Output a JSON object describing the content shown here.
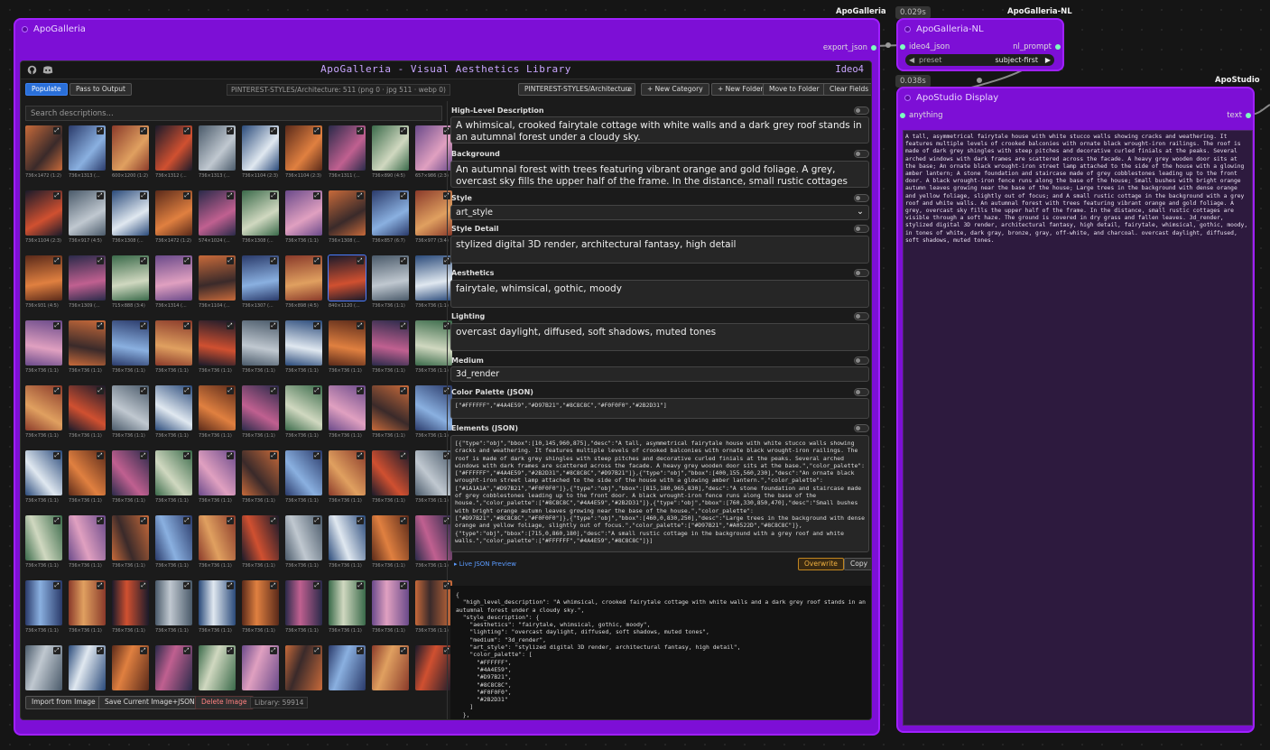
{
  "colors": {
    "node": "#7d0fd6",
    "border": "#a020ff",
    "accent": "#3b82f6",
    "socket": "#7dffc0"
  },
  "tags": {
    "gallery": "ApoGalleria",
    "nl": "ApoGalleria-NL",
    "studio": "ApoStudio"
  },
  "timings": {
    "nl": "0.029s",
    "studio": "0.038s"
  },
  "gallery_node": {
    "title": "ApoGalleria",
    "output": "export_json",
    "header_title": "ApoGalleria - Visual Aesthetics Library",
    "mode": "Ideo4",
    "populate": "Populate",
    "pass": "Pass to Output",
    "status": "PINTEREST-STYLES/Architecture: 511 (png 0 · jpg 511 · webp 0)",
    "category": "PINTEREST-STYLES/Architecture",
    "new_category": "+ New Category",
    "new_folder": "+ New Folder",
    "move": "Move to Folder",
    "clear": "Clear Fields",
    "search_placeholder": "Search descriptions...",
    "import": "Import from Image",
    "save": "Save Current Image+JSON",
    "delete": "Delete Image",
    "library": "Library: 59914"
  },
  "thumbs": [
    [
      "736×1472 (1:2)",
      "736×1313 (...",
      "600×1200 (1:2)",
      "736×1312 (...",
      "736×1313 (...",
      "736×1104 (2:3)",
      "736×1104 (2:3)",
      "736×1311 (...",
      "736×890 (4:5)",
      "657×986 (2:3)"
    ],
    [
      "736×1104 (2:3)",
      "736×917 (4:5)",
      "736×1308 (...",
      "736×1472 (1:2)",
      "574×1024 (...",
      "736×1308 (...",
      "736×736 (1:1)",
      "736×1308 (...",
      "736×857 (6:7)",
      "736×977 (3:4)"
    ],
    [
      "736×931 (4:5)",
      "736×1309 (...",
      "715×888 (3:4)",
      "736×1314 (...",
      "736×1104 (...",
      "736×1307 (...",
      "736×898 (4:5)",
      "840×1120 (...",
      "736×736 (1:1)",
      "736×736 (1:1)"
    ],
    [
      "736×736 (1:1)",
      "736×736 (1:1)",
      "736×736 (1:1)",
      "736×736 (1:1)",
      "736×736 (1:1)",
      "736×736 (1:1)",
      "736×736 (1:1)",
      "736×736 (1:1)",
      "736×736 (1:1)",
      "736×736 (1:1)"
    ],
    [
      "736×736 (1:1)",
      "736×736 (1:1)",
      "736×736 (1:1)",
      "736×736 (1:1)",
      "736×736 (1:1)",
      "736×736 (1:1)",
      "736×736 (1:1)",
      "736×736 (1:1)",
      "736×736 (1:1)",
      "736×736 (1:1)"
    ],
    [
      "736×736 (1:1)",
      "736×736 (1:1)",
      "736×736 (1:1)",
      "736×736 (1:1)",
      "736×736 (1:1)",
      "736×736 (1:1)",
      "736×736 (1:1)",
      "736×736 (1:1)",
      "736×736 (1:1)",
      "736×736 (1:1)"
    ],
    [
      "736×736 (1:1)",
      "736×736 (1:1)",
      "736×736 (1:1)",
      "736×736 (1:1)",
      "736×736 (1:1)",
      "736×736 (1:1)",
      "736×736 (1:1)",
      "736×736 (1:1)",
      "736×736 (1:1)",
      "736×736 (1:1)"
    ],
    [
      "736×736 (1:1)",
      "736×736 (1:1)",
      "736×736 (1:1)",
      "736×736 (1:1)",
      "736×736 (1:1)",
      "736×736 (1:1)",
      "736×736 (1:1)",
      "736×736 (1:1)",
      "736×736 (1:1)",
      "736×736 (1:1)"
    ],
    [
      "",
      "",
      "",
      "",
      "",
      "",
      "",
      "",
      "",
      ""
    ]
  ],
  "fields": {
    "hld_label": "High-Level Description",
    "hld": "A whimsical, crooked fairytale cottage with white walls and a dark grey roof stands in an autumnal forest under a cloudy sky.",
    "bg_label": "Background",
    "bg": "An autumnal forest with trees featuring vibrant orange and gold foliage. A grey, overcast sky fills the upper half of the frame. In the distance, small rustic cottages are visible through a soft haze. The ground is covered in dry grass and fallen leaves.",
    "style_label": "Style",
    "style": "art_style",
    "style_detail_label": "Style Detail",
    "style_detail": "stylized digital 3D render, architectural fantasy, high detail",
    "aesthetics_label": "Aesthetics",
    "aesthetics": "fairytale, whimsical, gothic, moody",
    "lighting_label": "Lighting",
    "lighting": "overcast daylight, diffused, soft shadows, muted tones",
    "medium_label": "Medium",
    "medium": "3d_render",
    "palette_label": "Color Palette (JSON)",
    "palette": "[\"#FFFFFF\",\"#4A4E59\",\"#D97B21\",\"#8C8C8C\",\"#F0F0F0\",\"#2B2D31\"]",
    "elements_label": "Elements (JSON)",
    "elements": "[{\"type\":\"obj\",\"bbox\":[10,145,960,875],\"desc\":\"A tall, asymmetrical fairytale house with white stucco walls showing cracks and weathering. It features multiple levels of crooked balconies with ornate black wrought-iron railings. The roof is made of dark grey shingles with steep pitches and decorative curled finials at the peaks. Several arched windows with dark frames are scattered across the facade. A heavy grey wooden door sits at the base.\",\"color_palette\":[\"#FFFFFF\",\"#4A4E59\",\"#2B2D31\",\"#8C8C8C\",\"#D97B21\"]},{\"type\":\"obj\",\"bbox\":[400,155,560,230],\"desc\":\"An ornate black wrought-iron street lamp attached to the side of the house with a glowing amber lantern.\",\"color_palette\":[\"#1A1A1A\",\"#D97B21\",\"#F0F0F0\"]},{\"type\":\"obj\",\"bbox\":[815,180,965,830],\"desc\":\"A stone foundation and staircase made of grey cobblestones leading up to the front door. A black wrought-iron fence runs along the base of the house.\",\"color_palette\":[\"#8C8C8C\",\"#4A4E59\",\"#2B2D31\"]},{\"type\":\"obj\",\"bbox\":[760,330,850,470],\"desc\":\"Small bushes with bright orange autumn leaves growing near the base of the house.\",\"color_palette\":[\"#D97B21\",\"#8C8C8C\",\"#F0F0F0\"]},{\"type\":\"obj\",\"bbox\":[460,0,830,250],\"desc\":\"Large trees in the background with dense orange and yellow foliage, slightly out of focus.\",\"color_palette\":[\"#D97B21\",\"#A0522D\",\"#8C8C8C\"]},{\"type\":\"obj\",\"bbox\":[715,0,860,180],\"desc\":\"A small rustic cottage in the background with a grey roof and white walls.\",\"color_palette\":[\"#FFFFFF\",\"#4A4E59\",\"#8C8C8C\"]}]",
    "live_preview": "▸ Live JSON Preview",
    "overwrite": "Overwrite",
    "copy": "Copy",
    "preview_json": "{\n  \"high_level_description\": \"A whimsical, crooked fairytale cottage with white walls and a dark grey roof stands in an\nautumnal forest under a cloudy sky.\",\n  \"style_description\": {\n    \"aesthetics\": \"fairytale, whimsical, gothic, moody\",\n    \"lighting\": \"overcast daylight, diffused, soft shadows, muted tones\",\n    \"medium\": \"3d_render\",\n    \"art_style\": \"stylized digital 3D render, architectural fantasy, high detail\",\n    \"color_palette\": [\n      \"#FFFFFF\",\n      \"#4A4E59\",\n      \"#D97B21\",\n      \"#8C8C8C\",\n      \"#F0F0F0\",\n      \"#2B2D31\"\n    ]\n  },"
  },
  "nl_node": {
    "title": "ApoGalleria-NL",
    "input": "ideo4_json",
    "output": "nl_prompt",
    "preset_label": "preset",
    "preset_value": "subject-first"
  },
  "studio_node": {
    "title": "ApoStudio Display",
    "input": "anything",
    "output": "text",
    "text": "A tall, asymmetrical fairytale house with white stucco walls showing cracks and weathering. It features multiple levels of crooked balconies with ornate black wrought-iron railings. The roof is made of dark grey shingles with steep pitches and decorative curled finials at the peaks. Several arched windows with dark frames are scattered across the facade. A heavy grey wooden door sits at the base; An ornate black wrought-iron street lamp attached to the side of the house with a glowing amber lantern; A stone foundation and staircase made of grey cobblestones leading up to the front door. A black wrought-iron fence runs along the base of the house; Small bushes with bright orange autumn leaves growing near the base of the house; Large trees in the background with dense orange and yellow foliage, slightly out of focus; and A small rustic cottage in the background with a grey roof and white walls. An autumnal forest with trees featuring vibrant orange and gold foliage. A grey, overcast sky fills the upper half of the frame. In the distance, small rustic cottages are visible through a soft haze. The ground is covered in dry grass and fallen leaves. 3d_render, stylized digital 3D render, architectural fantasy, high detail, fairytale, whimsical, gothic, moody, in tones of white, dark gray, bronze, gray, off-white, and charcoal. overcast daylight, diffused, soft shadows, muted tones."
  }
}
